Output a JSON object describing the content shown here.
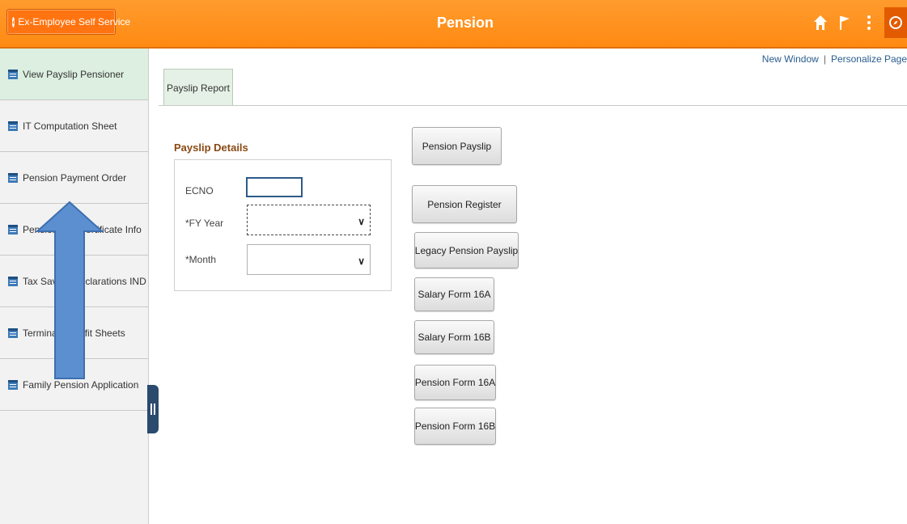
{
  "header": {
    "back_label": "Ex-Employee Self Service",
    "title": "Pension",
    "icons": [
      "home-icon",
      "flag-icon",
      "more-vert-icon",
      "navbar-compass-icon"
    ],
    "accent_color": "#ff8a12"
  },
  "toplinks": {
    "new_window": "New Window",
    "separator": "|",
    "personalize": "Personalize Page"
  },
  "leftnav": {
    "items": [
      {
        "label": "View Payslip Pensioner",
        "active": true
      },
      {
        "label": "IT Computation Sheet"
      },
      {
        "label": "Pension Payment Order"
      },
      {
        "label": "Pension Life Certificate Info",
        "visible_text": "Pension Li      cate Info"
      },
      {
        "label": "Tax Saving Declarations IND",
        "visible_text": "Tax Saving      ations IND"
      },
      {
        "label": "Terminal Benefit Sheets",
        "visible_text": "Terminal B      heets"
      },
      {
        "label": "Family Pension Application"
      }
    ]
  },
  "tab": {
    "label": "Payslip Report"
  },
  "payslip_details": {
    "title": "Payslip Details",
    "ecno_label": "ECNO",
    "ecno_value": "",
    "fy_label": "*FY Year",
    "fy_value": "",
    "month_label": "*Month",
    "month_value": ""
  },
  "buttons": {
    "pension_payslip": "Pension Payslip",
    "pension_register": "Pension Register",
    "legacy_payslip": "Legacy Pension Payslip",
    "form16a": "Salary Form 16A",
    "form16b": "Salary Form 16B",
    "pension16a": "Pension Form 16A",
    "pension16b": "Pension Form 16B"
  }
}
